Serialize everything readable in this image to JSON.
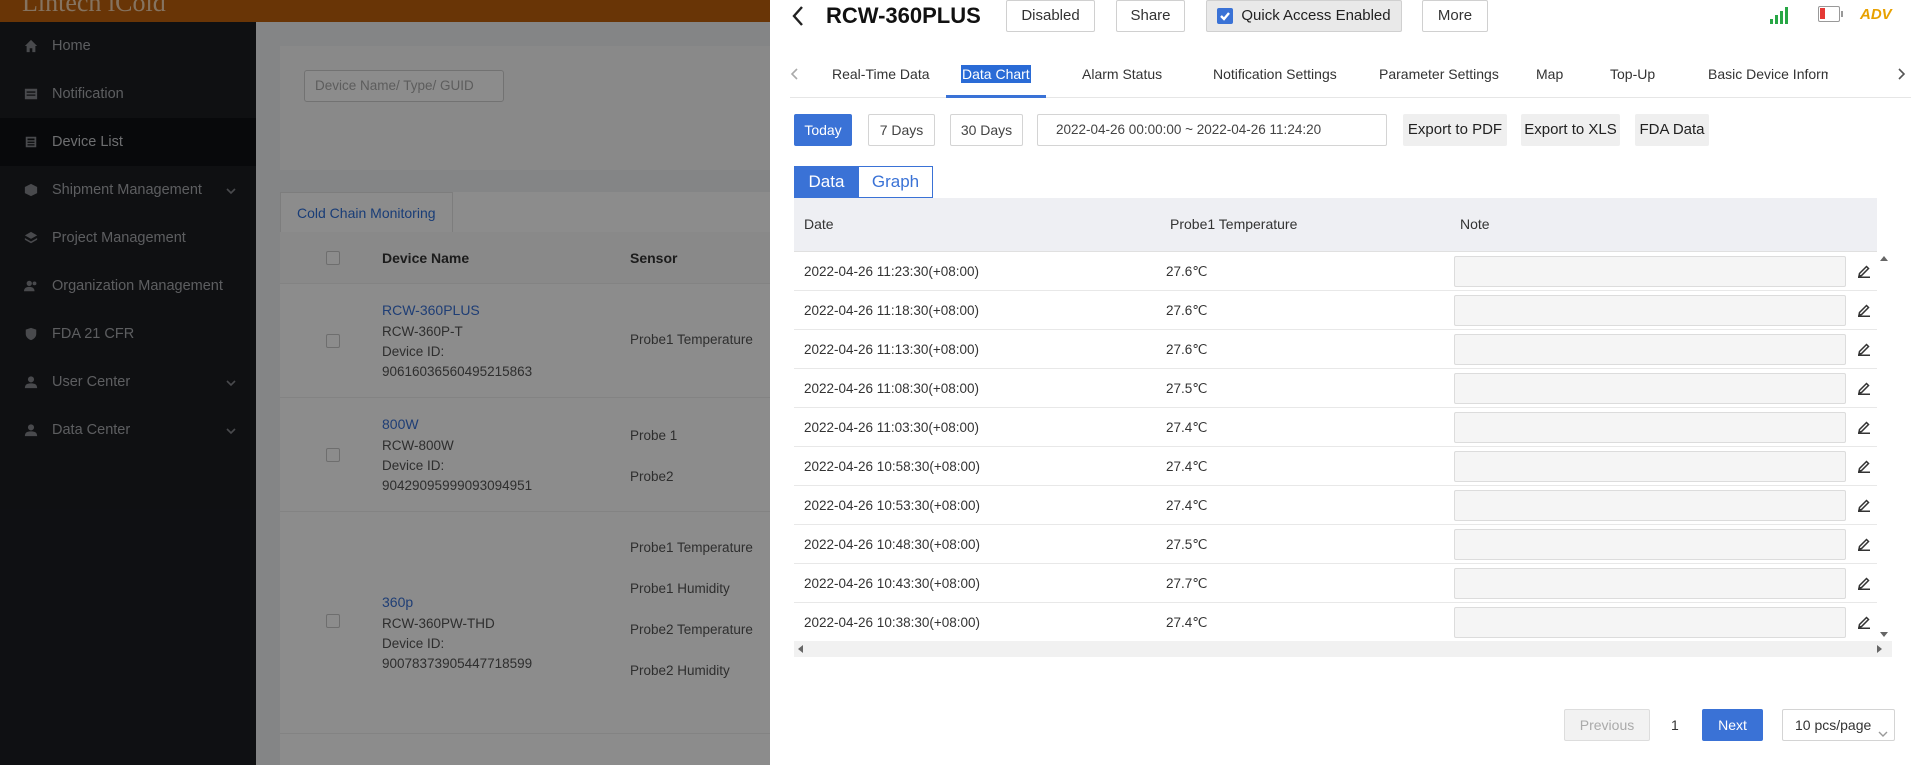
{
  "app": {
    "brand": "Lintech iCold"
  },
  "sidebar": {
    "items": [
      {
        "label": "Home",
        "icon": "home-icon"
      },
      {
        "label": "Notification",
        "icon": "message-icon"
      },
      {
        "label": "Device List",
        "icon": "device-icon",
        "active": true
      },
      {
        "label": "Shipment Management",
        "icon": "cube-icon",
        "expandable": true
      },
      {
        "label": "Project Management",
        "icon": "layers-icon"
      },
      {
        "label": "Organization Management",
        "icon": "users-icon"
      },
      {
        "label": "FDA 21 CFR",
        "icon": "shield-icon"
      },
      {
        "label": "User Center",
        "icon": "user-icon",
        "expandable": true
      },
      {
        "label": "Data Center",
        "icon": "user-icon",
        "expandable": true
      }
    ]
  },
  "main": {
    "search_placeholder": "Device Name/ Type/ GUID",
    "tab": "Cold Chain Monitoring",
    "columns": {
      "device_name": "Device Name",
      "sensor": "Sensor"
    },
    "devices": [
      {
        "name": "RCW-360PLUS",
        "model": "RCW-360P-T",
        "id_label": "Device ID:",
        "id": "90616036560495215863",
        "sensors": [
          "Probe1 Temperature"
        ]
      },
      {
        "name": "800W",
        "model": "RCW-800W",
        "id_label": "Device ID:",
        "id": "90429095999093094951",
        "sensors": [
          "Probe 1",
          "Probe2"
        ]
      },
      {
        "name": "360p",
        "model": "RCW-360PW-THD",
        "id_label": "Device ID:",
        "id": "90078373905447718599",
        "sensors": [
          "Probe1 Temperature",
          "Probe1 Humidity",
          "Probe2 Temperature",
          "Probe2 Humidity"
        ]
      }
    ]
  },
  "drawer": {
    "title": "RCW-360PLUS",
    "buttons": {
      "disabled": "Disabled",
      "share": "Share",
      "quick_access": "Quick Access Enabled",
      "more": "More"
    },
    "status": {
      "adv": "ADV",
      "signal": "signal-icon",
      "battery": "battery-low-icon"
    },
    "tabs": [
      "Real-Time Data",
      "Data Chart",
      "Alarm Status",
      "Notification Settings",
      "Parameter Settings",
      "Map",
      "Top-Up",
      "Basic Device Inform"
    ],
    "active_tab": "Data Chart",
    "range": {
      "today": "Today",
      "days7": "7 Days",
      "days30": "30 Days"
    },
    "date_range": "2022-04-26 00:00:00  ~  2022-04-26 11:24:20",
    "exports": {
      "pdf": "Export to PDF",
      "xls": "Export to XLS",
      "fda": "FDA Data"
    },
    "views": {
      "data": "Data",
      "graph": "Graph"
    },
    "table": {
      "headers": {
        "date": "Date",
        "temp": "Probe1 Temperature",
        "note": "Note"
      },
      "rows": [
        {
          "date": "2022-04-26 11:23:30(+08:00)",
          "temp": "27.6℃"
        },
        {
          "date": "2022-04-26 11:18:30(+08:00)",
          "temp": "27.6℃"
        },
        {
          "date": "2022-04-26 11:13:30(+08:00)",
          "temp": "27.6℃"
        },
        {
          "date": "2022-04-26 11:08:30(+08:00)",
          "temp": "27.5℃"
        },
        {
          "date": "2022-04-26 11:03:30(+08:00)",
          "temp": "27.4℃"
        },
        {
          "date": "2022-04-26 10:58:30(+08:00)",
          "temp": "27.4℃"
        },
        {
          "date": "2022-04-26 10:53:30(+08:00)",
          "temp": "27.4℃"
        },
        {
          "date": "2022-04-26 10:48:30(+08:00)",
          "temp": "27.5℃"
        },
        {
          "date": "2022-04-26 10:43:30(+08:00)",
          "temp": "27.7℃"
        },
        {
          "date": "2022-04-26 10:38:30(+08:00)",
          "temp": "27.4℃"
        }
      ]
    },
    "pagination": {
      "previous": "Previous",
      "page": "1",
      "next": "Next",
      "page_size": "10 pcs/page"
    }
  },
  "colors": {
    "brand": "#c0620b",
    "accent": "#3a72d6",
    "sidebar_bg": "#1c1e22",
    "signal": "#28a745",
    "battery_low": "#e53935",
    "adv": "#e8a100"
  }
}
